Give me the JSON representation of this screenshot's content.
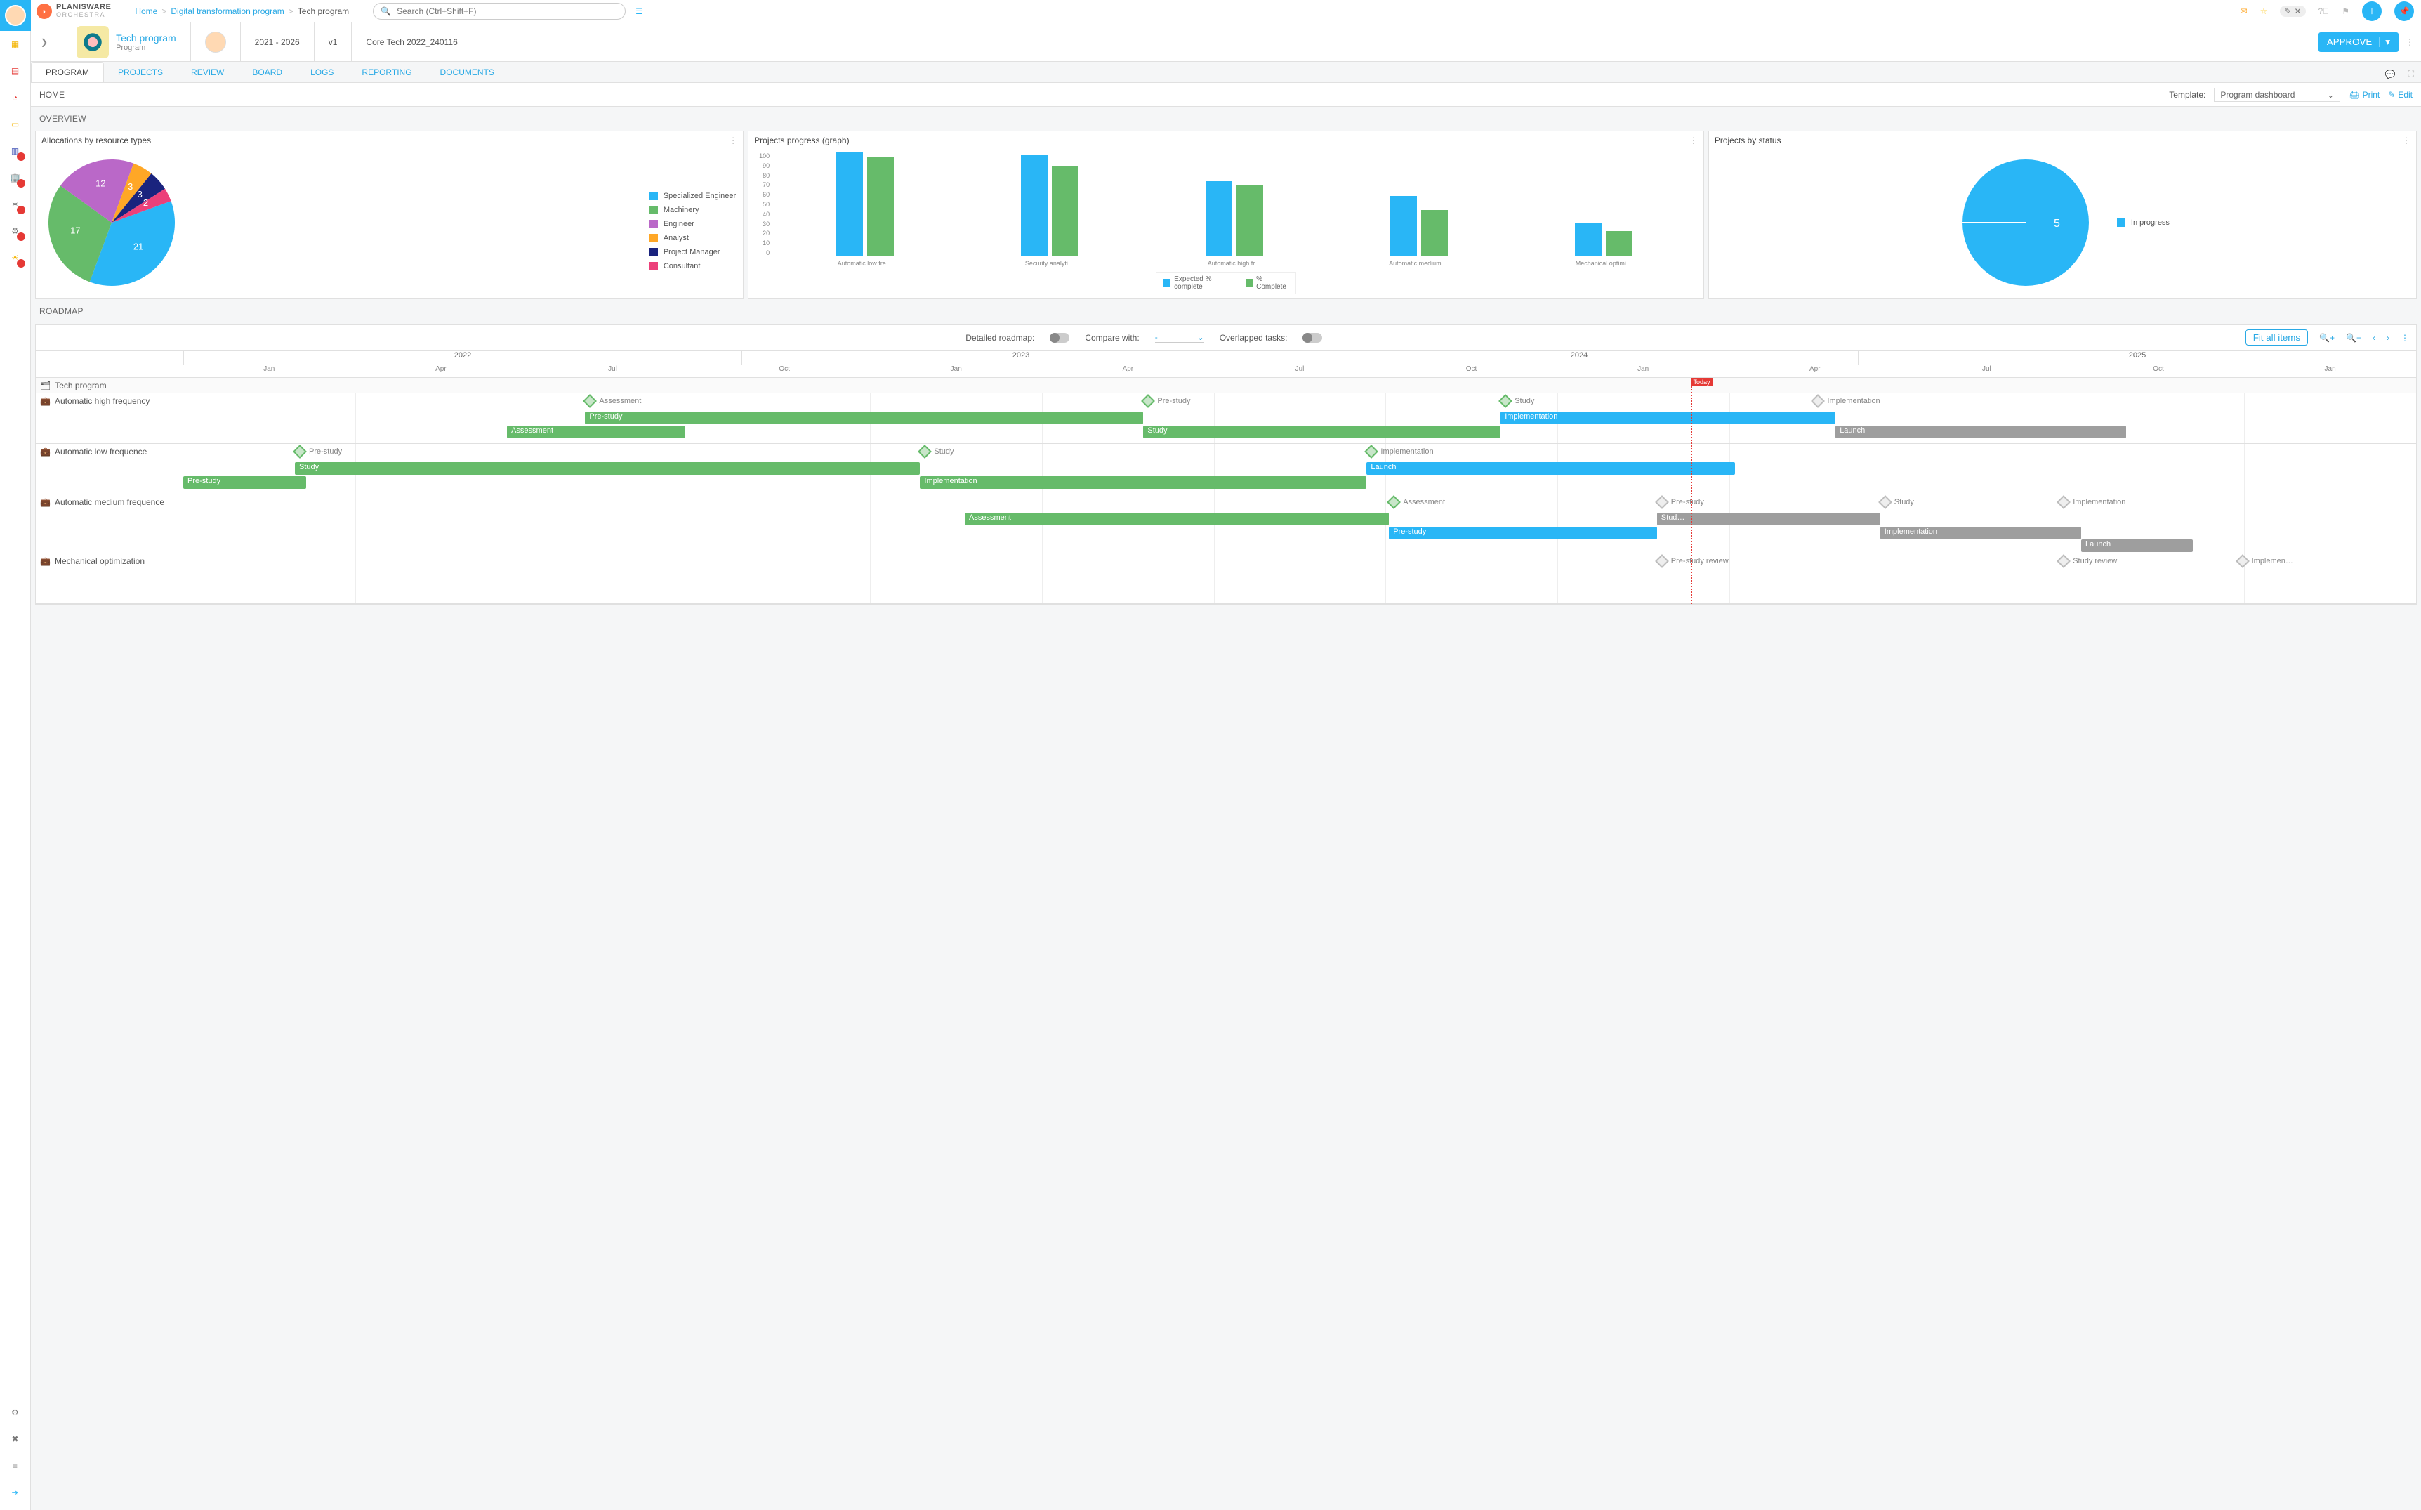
{
  "brand": {
    "name": "PLANISWARE",
    "sub": "ORCHESTRA"
  },
  "breadcrumb": {
    "home": "Home",
    "mid": "Digital transformation program",
    "last": "Tech program"
  },
  "search": {
    "placeholder": "Search (Ctrl+Shift+F)"
  },
  "program": {
    "title": "Tech program",
    "subtitle": "Program",
    "period": "2021 - 2026",
    "version": "v1",
    "baseline": "Core Tech 2022_240116",
    "approve": "APPROVE"
  },
  "tabs": [
    "PROGRAM",
    "PROJECTS",
    "REVIEW",
    "BOARD",
    "LOGS",
    "REPORTING",
    "DOCUMENTS"
  ],
  "subheader": {
    "home": "HOME",
    "template_label": "Template:",
    "template_value": "Program dashboard",
    "print": "Print",
    "edit": "Edit"
  },
  "overview": {
    "title": "OVERVIEW",
    "alloc": {
      "title": "Allocations by resource types",
      "legend": [
        {
          "name": "Specialized Engineer",
          "color": "#29b6f6",
          "value": 21
        },
        {
          "name": "Machinery",
          "color": "#66bb6a",
          "value": 17
        },
        {
          "name": "Engineer",
          "color": "#ba68c8",
          "value": 12
        },
        {
          "name": "Analyst",
          "color": "#ffa726",
          "value": 3
        },
        {
          "name": "Project Manager",
          "color": "#1a237e",
          "value": 3
        },
        {
          "name": "Consultant",
          "color": "#ec407a",
          "value": 2
        }
      ]
    },
    "progress": {
      "title": "Projects progress (graph)",
      "legend": {
        "expected": "Expected % complete",
        "complete": "% Complete"
      }
    },
    "status": {
      "title": "Projects by status",
      "legend": "In progress",
      "value": 5
    }
  },
  "chart_data": [
    {
      "type": "pie",
      "title": "Allocations by resource types",
      "series": [
        {
          "name": "Specialized Engineer",
          "value": 21
        },
        {
          "name": "Machinery",
          "value": 17
        },
        {
          "name": "Engineer",
          "value": 12
        },
        {
          "name": "Analyst",
          "value": 3
        },
        {
          "name": "Project Manager",
          "value": 3
        },
        {
          "name": "Consultant",
          "value": 2
        }
      ]
    },
    {
      "type": "bar",
      "title": "Projects progress (graph)",
      "ylabel": "",
      "ylim": [
        0,
        100
      ],
      "categories": [
        "Automatic low fre…",
        "Security analyti…",
        "Automatic high fr…",
        "Automatic medium …",
        "Mechanical optimi…"
      ],
      "series": [
        {
          "name": "Expected % complete",
          "values": [
            100,
            97,
            72,
            58,
            32
          ]
        },
        {
          "name": "% Complete",
          "values": [
            95,
            87,
            68,
            44,
            24
          ]
        }
      ]
    },
    {
      "type": "pie",
      "title": "Projects by status",
      "series": [
        {
          "name": "In progress",
          "value": 5
        }
      ]
    }
  ],
  "roadmap": {
    "title": "ROADMAP",
    "toolbar": {
      "detailed": "Detailed roadmap:",
      "compare": "Compare with:",
      "compare_value": "-",
      "overlap": "Overlapped tasks:",
      "fit": "Fit all items"
    },
    "years": [
      "2022",
      "2023",
      "2024",
      "2025"
    ],
    "months": [
      "Jan",
      "Apr",
      "Jul",
      "Oct",
      "Jan",
      "Apr",
      "Jul",
      "Oct",
      "Jan",
      "Apr",
      "Jul",
      "Oct",
      "Jan"
    ],
    "today_label": "Today",
    "group": "Tech  program",
    "rows": [
      {
        "name": "Automatic high frequency",
        "milestones": [
          {
            "label": "Assessment",
            "pos": 18,
            "done": true
          },
          {
            "label": "Pre-study",
            "pos": 43,
            "done": true
          },
          {
            "label": "Study",
            "pos": 59,
            "done": true
          },
          {
            "label": "Implementation",
            "pos": 73,
            "done": false
          }
        ],
        "bars": [
          {
            "label": "Pre-study",
            "color": "green",
            "top": 26,
            "left": 18,
            "width": 25
          },
          {
            "label": "Implementation",
            "color": "blue",
            "top": 26,
            "left": 59,
            "width": 15
          },
          {
            "label": "Assessment",
            "color": "green",
            "top": 46,
            "left": 14.5,
            "width": 8
          },
          {
            "label": "Study",
            "color": "green",
            "top": 46,
            "left": 43,
            "width": 16
          },
          {
            "label": "Launch",
            "color": "grey",
            "top": 46,
            "left": 74,
            "width": 13
          }
        ]
      },
      {
        "name": "Automatic low frequence",
        "milestones": [
          {
            "label": "Pre-study",
            "pos": 5,
            "done": true
          },
          {
            "label": "Study",
            "pos": 33,
            "done": true
          },
          {
            "label": "Implementation",
            "pos": 53,
            "done": true
          }
        ],
        "bars": [
          {
            "label": "Study",
            "color": "green",
            "top": 26,
            "left": 5,
            "width": 28
          },
          {
            "label": "Launch",
            "color": "blue",
            "top": 26,
            "left": 53,
            "width": 16.5
          },
          {
            "label": "Pre-study",
            "color": "green",
            "top": 46,
            "left": 0,
            "width": 5.5
          },
          {
            "label": "Implementation",
            "color": "green",
            "top": 46,
            "left": 33,
            "width": 20
          }
        ]
      },
      {
        "name": "Automatic medium frequence",
        "milestones": [
          {
            "label": "Assessment",
            "pos": 54,
            "done": true
          },
          {
            "label": "Pre-study",
            "pos": 66,
            "done": false
          },
          {
            "label": "Study",
            "pos": 76,
            "done": false
          },
          {
            "label": "Implementation",
            "pos": 84,
            "done": false
          }
        ],
        "bars": [
          {
            "label": "Assessment",
            "color": "green",
            "top": 26,
            "left": 35,
            "width": 19
          },
          {
            "label": "Stud…",
            "color": "grey",
            "top": 26,
            "left": 66,
            "width": 10
          },
          {
            "label": "Pre-study",
            "color": "blue",
            "top": 46,
            "left": 54,
            "width": 12
          },
          {
            "label": "Implementation",
            "color": "grey",
            "top": 46,
            "left": 76,
            "width": 9
          },
          {
            "label": "Launch",
            "color": "grey",
            "top": 64,
            "left": 85,
            "width": 5
          }
        ]
      },
      {
        "name": "Mechanical optimization",
        "milestones": [
          {
            "label": "Pre-study review",
            "pos": 66,
            "done": false
          },
          {
            "label": "Study review",
            "pos": 84,
            "done": false
          },
          {
            "label": "Implemen…",
            "pos": 92,
            "done": false
          }
        ],
        "bars": []
      }
    ]
  }
}
